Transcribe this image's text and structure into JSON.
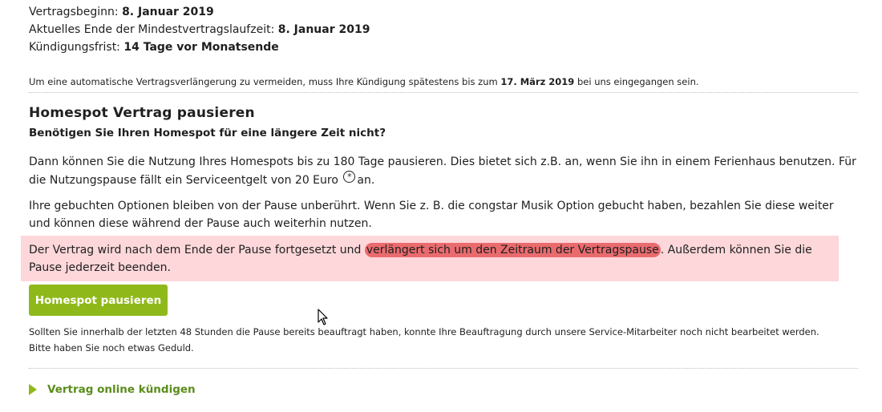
{
  "contract": {
    "start_label": "Vertragsbeginn:",
    "start_value": "8. Januar 2019",
    "end_label": "Aktuelles Ende der Mindestvertragslaufzeit:",
    "end_value": "8. Januar 2019",
    "notice_label": "Kündigungsfrist:",
    "notice_value": "14 Tage vor Monatsende",
    "auto_renew_prefix": "Um eine automatische Vertragsverlängerung zu vermeiden, muss Ihre Kündigung spätestens bis zum",
    "auto_renew_date": "17. März 2019",
    "auto_renew_suffix": "bei uns eingegangen sein."
  },
  "pause": {
    "title": "Homespot Vertrag pausieren",
    "subtitle": "Benötigen Sie Ihren Homespot für eine längere Zeit nicht?",
    "para1_before": "Dann können Sie die Nutzung Ihres Homespots bis zu 180 Tage pausieren. Dies bietet sich z.B. an, wenn Sie ihn in einem Ferienhaus benutzen. Für die Nutzungspause fällt ein Serviceentgelt von 20 Euro",
    "para1_footnote": "*",
    "para1_after": "an.",
    "para2": "Ihre gebuchten Optionen bleiben von der Pause unberührt. Wenn Sie z. B. die congstar Musik Option gebucht haben, bezahlen Sie diese weiter und können diese während der Pause auch weiterhin nutzen.",
    "para3_before": "Der Vertrag wird nach dem Ende der Pause fortgesetzt und",
    "para3_marked": "verlängert sich um den Zeitraum der Vertragspause",
    "para3_after": ". Außerdem können Sie die Pause jederzeit beenden.",
    "button_label": "Homespot pausieren",
    "note": "Sollten Sie innerhalb der letzten 48 Stunden die Pause bereits beauftragt haben, konnte Ihre Beauftragung durch unsere Service-Mitarbeiter noch nicht bearbeitet werden. Bitte haben Sie noch etwas Geduld."
  },
  "footer": {
    "cancel_link": "Vertrag online kündigen"
  },
  "colors": {
    "accent": "#8fb91a",
    "link": "#5a8c1a",
    "highlight_bg": "#fdd7da",
    "marker": "#ea6b6e"
  },
  "icons": {
    "cursor": "mouse-pointer-icon",
    "link_arrow": "play-arrow-icon"
  }
}
